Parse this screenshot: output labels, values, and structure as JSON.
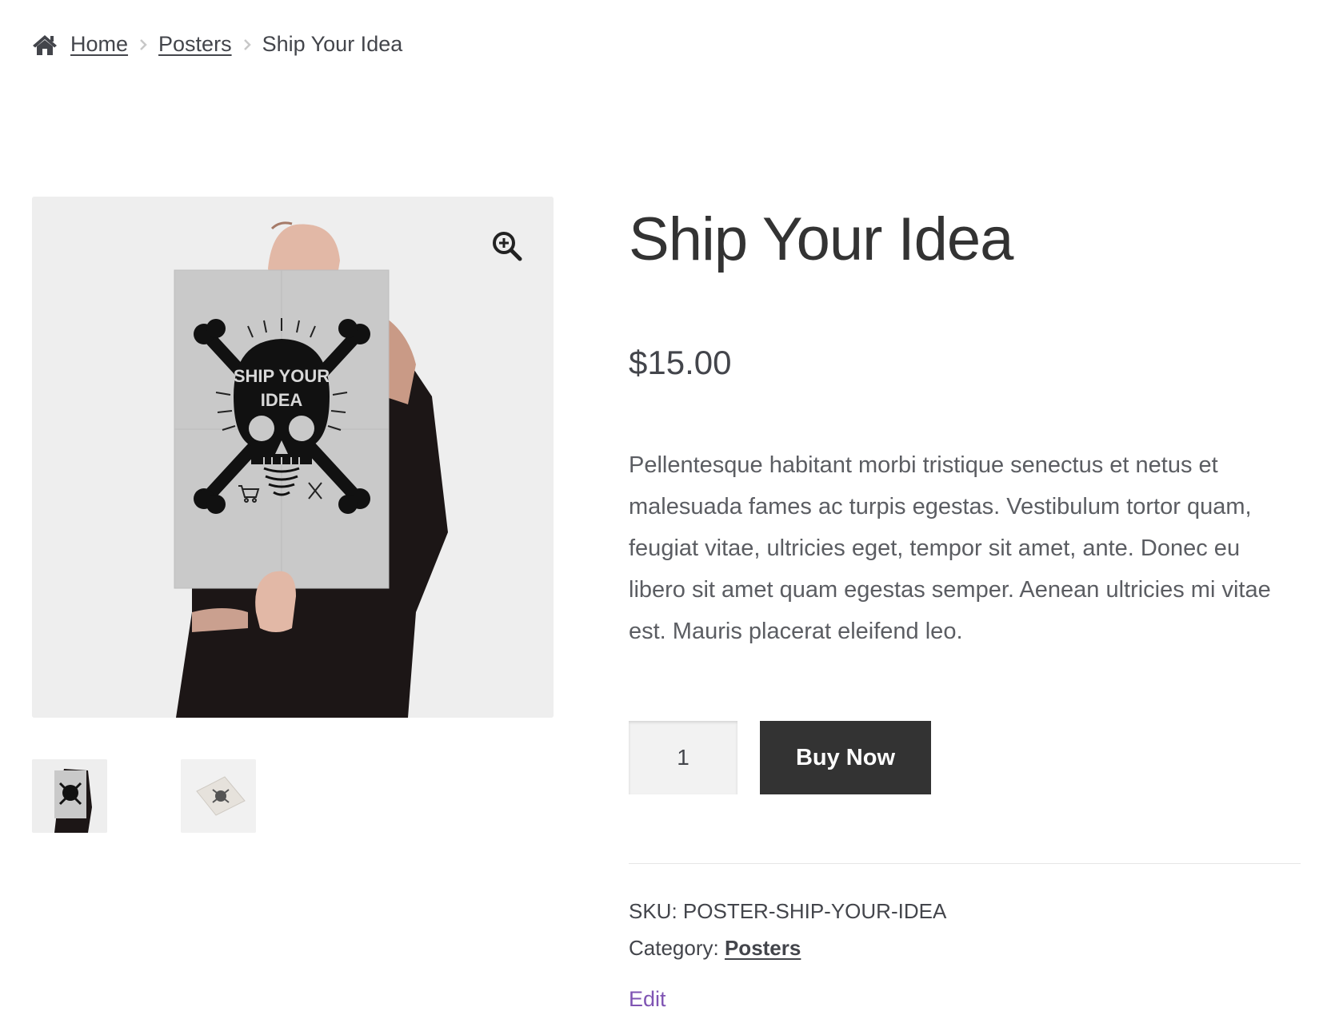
{
  "breadcrumb": {
    "home_icon": "home-icon",
    "items": [
      {
        "label": "Home"
      },
      {
        "label": "Posters"
      }
    ],
    "current": "Ship Your Idea"
  },
  "gallery": {
    "zoom_icon": "zoom-in-icon",
    "main_image": "poster-ship-your-idea-held-by-hands",
    "poster_text": "SHIP YOUR IDEA",
    "thumbnails": [
      "poster-held-thumbnail",
      "poster-flat-thumbnail"
    ]
  },
  "product": {
    "title": "Ship Your Idea",
    "price": "$15.00",
    "description": "Pellentesque habitant morbi tristique senectus et netus et malesuada fames ac turpis egestas. Vestibulum tortor quam, feugiat vitae, ultricies eget, tempor sit amet, ante. Donec eu libero sit amet quam egestas semper. Aenean ultricies mi vitae est. Mauris placerat eleifend leo.",
    "quantity": "1",
    "buy_label": "Buy Now"
  },
  "meta": {
    "sku_label": "SKU:",
    "sku_value": "POSTER-SHIP-YOUR-IDEA",
    "category_label": "Category:",
    "category_value": "Posters",
    "edit_label": "Edit"
  },
  "colors": {
    "button_bg": "#333333",
    "edit_link": "#7f54b3",
    "gallery_bg": "#eeeeee"
  }
}
